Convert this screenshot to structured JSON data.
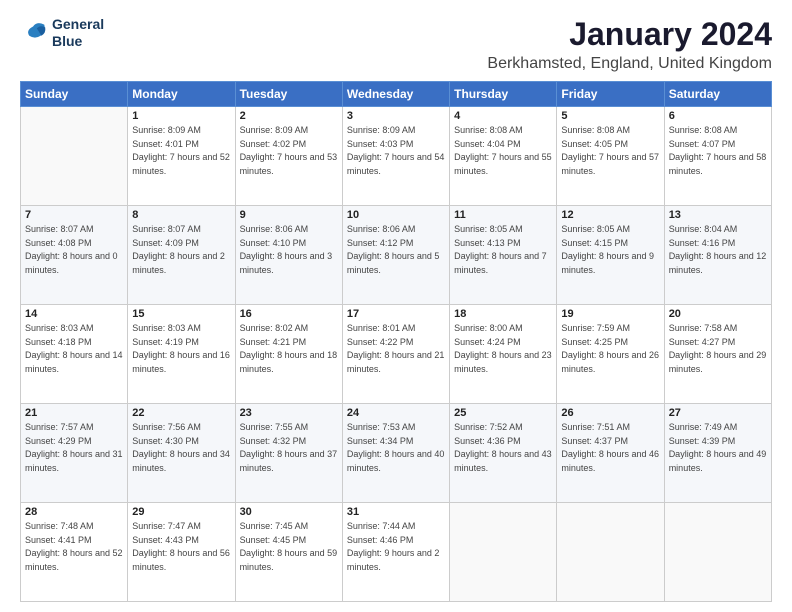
{
  "logo": {
    "line1": "General",
    "line2": "Blue"
  },
  "title": "January 2024",
  "subtitle": "Berkhamsted, England, United Kingdom",
  "days_of_week": [
    "Sunday",
    "Monday",
    "Tuesday",
    "Wednesday",
    "Thursday",
    "Friday",
    "Saturday"
  ],
  "weeks": [
    [
      {
        "day": "",
        "sunrise": "",
        "sunset": "",
        "daylight": ""
      },
      {
        "day": "1",
        "sunrise": "Sunrise: 8:09 AM",
        "sunset": "Sunset: 4:01 PM",
        "daylight": "Daylight: 7 hours and 52 minutes."
      },
      {
        "day": "2",
        "sunrise": "Sunrise: 8:09 AM",
        "sunset": "Sunset: 4:02 PM",
        "daylight": "Daylight: 7 hours and 53 minutes."
      },
      {
        "day": "3",
        "sunrise": "Sunrise: 8:09 AM",
        "sunset": "Sunset: 4:03 PM",
        "daylight": "Daylight: 7 hours and 54 minutes."
      },
      {
        "day": "4",
        "sunrise": "Sunrise: 8:08 AM",
        "sunset": "Sunset: 4:04 PM",
        "daylight": "Daylight: 7 hours and 55 minutes."
      },
      {
        "day": "5",
        "sunrise": "Sunrise: 8:08 AM",
        "sunset": "Sunset: 4:05 PM",
        "daylight": "Daylight: 7 hours and 57 minutes."
      },
      {
        "day": "6",
        "sunrise": "Sunrise: 8:08 AM",
        "sunset": "Sunset: 4:07 PM",
        "daylight": "Daylight: 7 hours and 58 minutes."
      }
    ],
    [
      {
        "day": "7",
        "sunrise": "Sunrise: 8:07 AM",
        "sunset": "Sunset: 4:08 PM",
        "daylight": "Daylight: 8 hours and 0 minutes."
      },
      {
        "day": "8",
        "sunrise": "Sunrise: 8:07 AM",
        "sunset": "Sunset: 4:09 PM",
        "daylight": "Daylight: 8 hours and 2 minutes."
      },
      {
        "day": "9",
        "sunrise": "Sunrise: 8:06 AM",
        "sunset": "Sunset: 4:10 PM",
        "daylight": "Daylight: 8 hours and 3 minutes."
      },
      {
        "day": "10",
        "sunrise": "Sunrise: 8:06 AM",
        "sunset": "Sunset: 4:12 PM",
        "daylight": "Daylight: 8 hours and 5 minutes."
      },
      {
        "day": "11",
        "sunrise": "Sunrise: 8:05 AM",
        "sunset": "Sunset: 4:13 PM",
        "daylight": "Daylight: 8 hours and 7 minutes."
      },
      {
        "day": "12",
        "sunrise": "Sunrise: 8:05 AM",
        "sunset": "Sunset: 4:15 PM",
        "daylight": "Daylight: 8 hours and 9 minutes."
      },
      {
        "day": "13",
        "sunrise": "Sunrise: 8:04 AM",
        "sunset": "Sunset: 4:16 PM",
        "daylight": "Daylight: 8 hours and 12 minutes."
      }
    ],
    [
      {
        "day": "14",
        "sunrise": "Sunrise: 8:03 AM",
        "sunset": "Sunset: 4:18 PM",
        "daylight": "Daylight: 8 hours and 14 minutes."
      },
      {
        "day": "15",
        "sunrise": "Sunrise: 8:03 AM",
        "sunset": "Sunset: 4:19 PM",
        "daylight": "Daylight: 8 hours and 16 minutes."
      },
      {
        "day": "16",
        "sunrise": "Sunrise: 8:02 AM",
        "sunset": "Sunset: 4:21 PM",
        "daylight": "Daylight: 8 hours and 18 minutes."
      },
      {
        "day": "17",
        "sunrise": "Sunrise: 8:01 AM",
        "sunset": "Sunset: 4:22 PM",
        "daylight": "Daylight: 8 hours and 21 minutes."
      },
      {
        "day": "18",
        "sunrise": "Sunrise: 8:00 AM",
        "sunset": "Sunset: 4:24 PM",
        "daylight": "Daylight: 8 hours and 23 minutes."
      },
      {
        "day": "19",
        "sunrise": "Sunrise: 7:59 AM",
        "sunset": "Sunset: 4:25 PM",
        "daylight": "Daylight: 8 hours and 26 minutes."
      },
      {
        "day": "20",
        "sunrise": "Sunrise: 7:58 AM",
        "sunset": "Sunset: 4:27 PM",
        "daylight": "Daylight: 8 hours and 29 minutes."
      }
    ],
    [
      {
        "day": "21",
        "sunrise": "Sunrise: 7:57 AM",
        "sunset": "Sunset: 4:29 PM",
        "daylight": "Daylight: 8 hours and 31 minutes."
      },
      {
        "day": "22",
        "sunrise": "Sunrise: 7:56 AM",
        "sunset": "Sunset: 4:30 PM",
        "daylight": "Daylight: 8 hours and 34 minutes."
      },
      {
        "day": "23",
        "sunrise": "Sunrise: 7:55 AM",
        "sunset": "Sunset: 4:32 PM",
        "daylight": "Daylight: 8 hours and 37 minutes."
      },
      {
        "day": "24",
        "sunrise": "Sunrise: 7:53 AM",
        "sunset": "Sunset: 4:34 PM",
        "daylight": "Daylight: 8 hours and 40 minutes."
      },
      {
        "day": "25",
        "sunrise": "Sunrise: 7:52 AM",
        "sunset": "Sunset: 4:36 PM",
        "daylight": "Daylight: 8 hours and 43 minutes."
      },
      {
        "day": "26",
        "sunrise": "Sunrise: 7:51 AM",
        "sunset": "Sunset: 4:37 PM",
        "daylight": "Daylight: 8 hours and 46 minutes."
      },
      {
        "day": "27",
        "sunrise": "Sunrise: 7:49 AM",
        "sunset": "Sunset: 4:39 PM",
        "daylight": "Daylight: 8 hours and 49 minutes."
      }
    ],
    [
      {
        "day": "28",
        "sunrise": "Sunrise: 7:48 AM",
        "sunset": "Sunset: 4:41 PM",
        "daylight": "Daylight: 8 hours and 52 minutes."
      },
      {
        "day": "29",
        "sunrise": "Sunrise: 7:47 AM",
        "sunset": "Sunset: 4:43 PM",
        "daylight": "Daylight: 8 hours and 56 minutes."
      },
      {
        "day": "30",
        "sunrise": "Sunrise: 7:45 AM",
        "sunset": "Sunset: 4:45 PM",
        "daylight": "Daylight: 8 hours and 59 minutes."
      },
      {
        "day": "31",
        "sunrise": "Sunrise: 7:44 AM",
        "sunset": "Sunset: 4:46 PM",
        "daylight": "Daylight: 9 hours and 2 minutes."
      },
      {
        "day": "",
        "sunrise": "",
        "sunset": "",
        "daylight": ""
      },
      {
        "day": "",
        "sunrise": "",
        "sunset": "",
        "daylight": ""
      },
      {
        "day": "",
        "sunrise": "",
        "sunset": "",
        "daylight": ""
      }
    ]
  ]
}
